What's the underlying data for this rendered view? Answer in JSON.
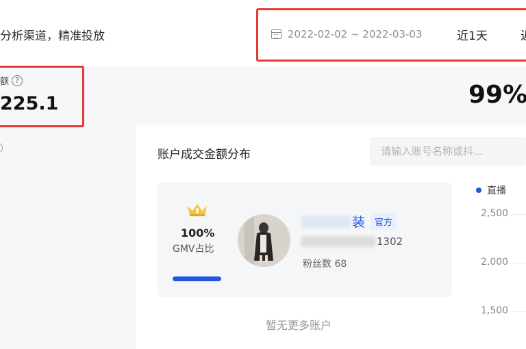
{
  "header": {
    "subtitle": "分析渠道，精准投放",
    "date_range": "2022-02-02 ~ 2022-03-03",
    "range_1d_label": "近1天",
    "range_more_label": "近"
  },
  "stats": {
    "amount_label": "额",
    "amount_value": "225.1",
    "percent_value": "99%",
    "help_symbol": "?"
  },
  "panel": {
    "title": "账户成交金额分布",
    "search_placeholder": "请输入账号名称或抖...",
    "empty_text": "暂无更多账户"
  },
  "account": {
    "gmv_percent": "100%",
    "gmv_percent_value": 1.0,
    "gmv_label": "GMV占比",
    "name_suffix": "装",
    "official_badge": "官方",
    "id_suffix": "1302",
    "fans_text": "粉丝数 68"
  },
  "chart": {
    "legend_label": "直播",
    "y_ticks": [
      "2,500",
      "2,000",
      "1,500"
    ]
  },
  "colors": {
    "accent": "#2255e0",
    "highlight_box": "#e53935",
    "panel_bg": "#f5f6f8"
  }
}
